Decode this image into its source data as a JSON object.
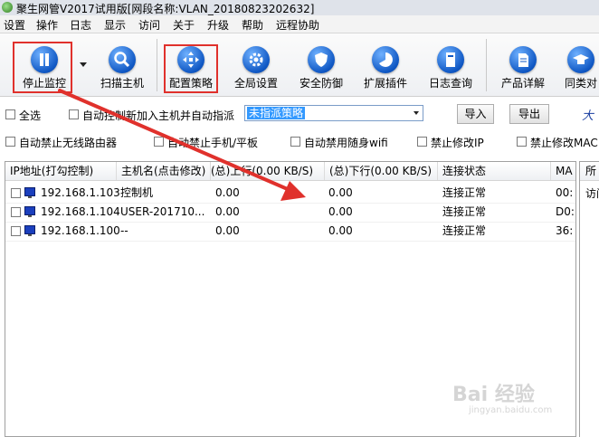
{
  "window": {
    "title": "聚生网管V2017试用版[网段名称:VLAN_20180823202632]"
  },
  "menu": [
    "设置",
    "操作",
    "日志",
    "显示",
    "访问",
    "关于",
    "升级",
    "帮助",
    "远程协助"
  ],
  "toolbar": {
    "buttons": [
      {
        "label": "停止监控",
        "icon": "pause-icon"
      },
      {
        "label": "扫描主机",
        "icon": "magnifier-icon"
      },
      {
        "label": "配置策略",
        "icon": "move-arrows-icon"
      },
      {
        "label": "全局设置",
        "icon": "gear-icon"
      },
      {
        "label": "安全防御",
        "icon": "shield-icon"
      },
      {
        "label": "扩展插件",
        "icon": "pie-icon"
      },
      {
        "label": "日志查询",
        "icon": "book-icon"
      },
      {
        "label": "产品详解",
        "icon": "document-icon"
      },
      {
        "label": "同类对",
        "icon": "graduation-cap-icon"
      }
    ]
  },
  "options": {
    "select_all": "全选",
    "auto_control_new_host": "自动控制新加入主机并自动指派",
    "strategy_value": "未指派策略",
    "import_label": "导入",
    "export_label": "导出",
    "right_text": "大",
    "auto_disable_wireless_router": "自动禁止无线路由器",
    "auto_disable_phone_tablet": "自动禁止手机/平板",
    "auto_disable_portable_wifi": "自动禁用随身wifi",
    "forbid_modify_ip": "禁止修改IP",
    "forbid_modify_mac": "禁止修改MAC"
  },
  "table": {
    "columns": [
      "IP地址(打勾控制)",
      "主机名(点击修改)",
      "(总)上行(0.00 KB/S)",
      "(总)下行(0.00 KB/S)",
      "连接状态",
      "MA"
    ],
    "rows": [
      {
        "ip": "192.168.1.103",
        "hostname": "控制机",
        "upload": "0.00",
        "download": "0.00",
        "status": "连接正常",
        "mac": "00:"
      },
      {
        "ip": "192.168.1.104",
        "hostname": "USER-201710...",
        "upload": "0.00",
        "download": "0.00",
        "status": "连接正常",
        "mac": "D0:"
      },
      {
        "ip": "192.168.1.100",
        "hostname": "--",
        "upload": "0.00",
        "download": "0.00",
        "status": "连接正常",
        "mac": "36:"
      }
    ]
  },
  "side_panel": {
    "header": "所",
    "content": "访问"
  },
  "watermark": {
    "brand": "Bai 经验",
    "url": "jingyan.baidu.com"
  },
  "colors": {
    "annotation_red": "#e0312c",
    "selection_blue": "#3399ff",
    "icon_blue": "#1058c4"
  }
}
